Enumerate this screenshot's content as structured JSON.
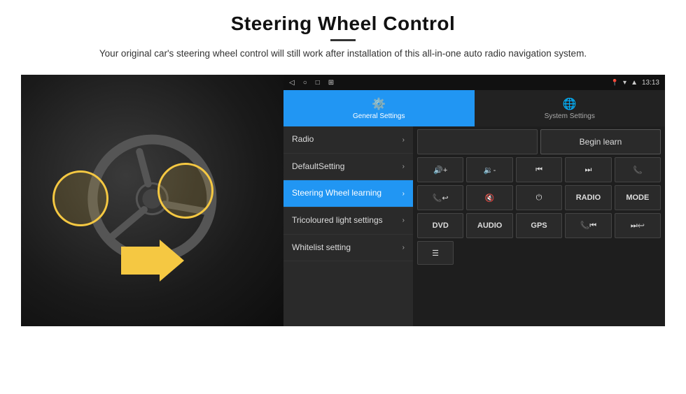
{
  "header": {
    "title": "Steering Wheel Control",
    "divider": true,
    "subtitle": "Your original car's steering wheel control will still work after installation of this all-in-one auto radio navigation system."
  },
  "status_bar": {
    "back_icon": "◁",
    "circle_icon": "○",
    "square_icon": "□",
    "grid_icon": "⊞",
    "wifi_icon": "▾",
    "signal_icon": "▲",
    "time": "13:13"
  },
  "tabs": [
    {
      "id": "general",
      "label": "General Settings",
      "icon": "⚙",
      "active": true
    },
    {
      "id": "system",
      "label": "System Settings",
      "icon": "🌐",
      "active": false
    }
  ],
  "menu_items": [
    {
      "id": "radio",
      "label": "Radio",
      "active": false
    },
    {
      "id": "default",
      "label": "DefaultSetting",
      "active": false
    },
    {
      "id": "steering",
      "label": "Steering Wheel learning",
      "active": true
    },
    {
      "id": "tricolour",
      "label": "Tricoloured light settings",
      "active": false
    },
    {
      "id": "whitelist",
      "label": "Whitelist setting",
      "active": false
    }
  ],
  "controls": {
    "begin_learn_label": "Begin learn",
    "row1": [
      {
        "id": "vol_up",
        "symbol": "🔊+",
        "label": "VOL+"
      },
      {
        "id": "vol_down",
        "symbol": "🔉-",
        "label": "VOL-"
      },
      {
        "id": "prev_track",
        "symbol": "⏮",
        "label": "PREV"
      },
      {
        "id": "next_track",
        "symbol": "⏭",
        "label": "NEXT"
      },
      {
        "id": "phone",
        "symbol": "✆",
        "label": "PHONE"
      }
    ],
    "row2": [
      {
        "id": "answer",
        "symbol": "↩",
        "label": "ANS"
      },
      {
        "id": "mute",
        "symbol": "🔇",
        "label": "MUTE"
      },
      {
        "id": "power",
        "symbol": "⏻",
        "label": "PWR"
      },
      {
        "id": "radio_btn",
        "symbol": "RADIO",
        "label": "RADIO"
      },
      {
        "id": "mode",
        "symbol": "MODE",
        "label": "MODE"
      }
    ],
    "row3": [
      {
        "id": "dvd",
        "symbol": "DVD",
        "label": "DVD"
      },
      {
        "id": "audio",
        "symbol": "AUDIO",
        "label": "AUDIO"
      },
      {
        "id": "gps",
        "symbol": "GPS",
        "label": "GPS"
      },
      {
        "id": "phone2",
        "symbol": "✆⏮",
        "label": "TEL+PREV"
      },
      {
        "id": "skip",
        "symbol": "⏭↩",
        "label": "SKIP"
      }
    ],
    "bottom_icon": "☰"
  }
}
